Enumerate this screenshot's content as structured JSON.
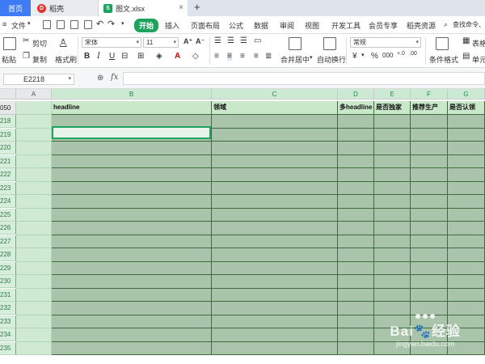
{
  "tabs": [
    {
      "label": "首页"
    },
    {
      "label": "稻壳"
    },
    {
      "label": "图文.xlsx"
    }
  ],
  "menu": {
    "file": "文件",
    "items": [
      "开始",
      "插入",
      "页面布局",
      "公式",
      "数据",
      "审阅",
      "视图",
      "开发工具",
      "会员专享",
      "稻壳资源"
    ],
    "search": "查找命令、"
  },
  "ribbon": {
    "cut": "剪切",
    "copy": "复制",
    "paste": "粘贴",
    "format_painter": "格式刷",
    "font_name": "宋体",
    "font_size": "11",
    "merge_center": "合并居中",
    "wrap_text": "自动换行",
    "number_format": "常规",
    "cond_format": "条件格式",
    "table_style": "表格",
    "cell": "单元",
    "pct": "%",
    "thousand": "000"
  },
  "formula_bar": {
    "name_box": "E2218",
    "fx": "fx",
    "value": ""
  },
  "sheet": {
    "columns": [
      "A",
      "B",
      "C",
      "D",
      "E",
      "F",
      "G"
    ],
    "header_row": {
      "row_num": "050",
      "cells": [
        "",
        "headline",
        "领域",
        "多headline",
        "是否独家",
        "推荐生产",
        "是否认领"
      ]
    },
    "rows": [
      "218",
      "219",
      "220",
      "221",
      "222",
      "223",
      "224",
      "225",
      "226",
      "227",
      "228",
      "229",
      "230",
      "231",
      "232",
      "233",
      "234",
      "235"
    ]
  },
  "watermark": {
    "brand_left": "Bai",
    "brand_right": "经验",
    "url": "jingyan.baidu.com"
  }
}
